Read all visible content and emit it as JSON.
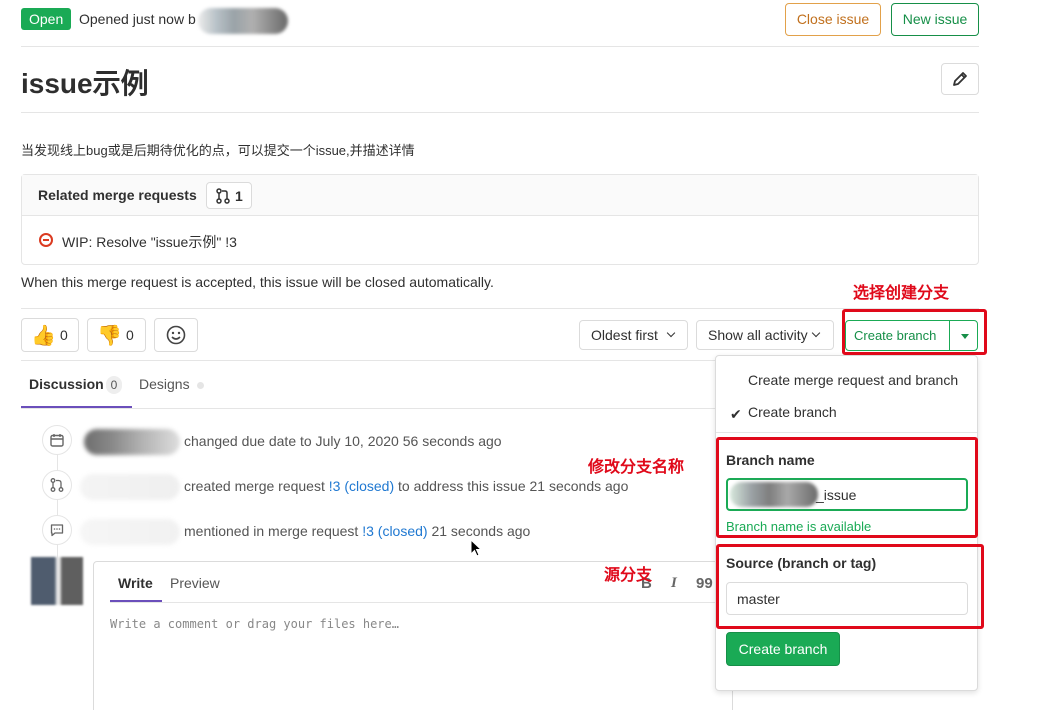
{
  "header": {
    "status": "Open",
    "opened_text": "Opened just now b",
    "close_issue_label": "Close issue",
    "new_issue_label": "New issue"
  },
  "issue": {
    "title": "issue示例",
    "description": "当发现线上bug或是后期待优化的点，可以提交一个issue,并描述详情"
  },
  "related_mrs": {
    "title": "Related merge requests",
    "count": "1",
    "items": [
      {
        "text": "WIP: Resolve \"issue示例\"  !3"
      }
    ],
    "footer": "When this merge request is accepted, this issue will be closed automatically."
  },
  "awards": {
    "thumbsup_emoji": "👍",
    "thumbsup_count": "0",
    "thumbsdown_emoji": "👎",
    "thumbsdown_count": "0",
    "smiley_icon": "☺"
  },
  "toolbar": {
    "sort_label": "Oldest first",
    "filter_label": "Show all activity",
    "create_branch_label": "Create branch"
  },
  "annotations": {
    "select_branch": "选择创建分支",
    "edit_branch_name": "修改分支名称",
    "source_branch": "源分支"
  },
  "tabs": {
    "discussion_label": "Discussion",
    "discussion_count": "0",
    "designs_label": "Designs"
  },
  "timeline": [
    {
      "text": "changed due date to July 10, 2020 56 seconds ago"
    },
    {
      "pre": "created merge request ",
      "link": "!3 (closed)",
      "post": " to address this issue 21 seconds ago"
    },
    {
      "pre": "mentioned in merge request ",
      "link": "!3 (closed)",
      "post": " 21 seconds ago"
    }
  ],
  "comment": {
    "write_tab": "Write",
    "preview_tab": "Preview",
    "placeholder": "Write a comment or drag your files here…",
    "tool_bold": "B",
    "tool_italic": "I",
    "tool_quote": "99"
  },
  "dropdown": {
    "option_mr_and_branch": "Create merge request and branch",
    "option_branch": "Create branch",
    "check_mark": "✔",
    "branch_name_label": "Branch name",
    "branch_name_suffix": "_issue",
    "branch_available": "Branch name is available",
    "source_label": "Source (branch or tag)",
    "source_value": "master",
    "submit_label": "Create branch"
  },
  "colors": {
    "success": "#1aaa55",
    "warning": "#c1701d",
    "annotation_red": "#e0091a",
    "link": "#1f78d1",
    "tab_active": "#6b4fbb"
  }
}
